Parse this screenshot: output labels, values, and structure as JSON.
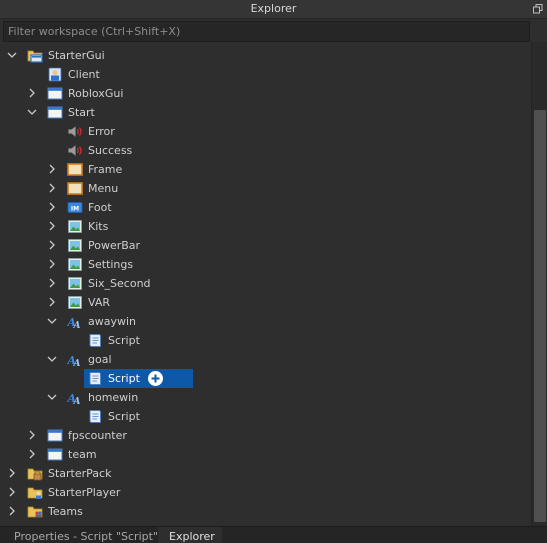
{
  "window": {
    "title": "Explorer"
  },
  "filter": {
    "placeholder": "Filter workspace (Ctrl+Shift+X)"
  },
  "tree": [
    {
      "label": "StarterGui",
      "icon": "startergui-folder-icon",
      "chevron": "down",
      "depth": 0
    },
    {
      "label": "Client",
      "icon": "localscript-icon",
      "chevron": "none",
      "depth": 1
    },
    {
      "label": "RobloxGui",
      "icon": "screengui-icon",
      "chevron": "right",
      "depth": 1
    },
    {
      "label": "Start",
      "icon": "screengui-icon",
      "chevron": "down",
      "depth": 1
    },
    {
      "label": "Error",
      "icon": "sound-icon",
      "chevron": "none",
      "depth": 2
    },
    {
      "label": "Success",
      "icon": "sound-icon",
      "chevron": "none",
      "depth": 2
    },
    {
      "label": "Frame",
      "icon": "frame-icon",
      "chevron": "right",
      "depth": 2
    },
    {
      "label": "Menu",
      "icon": "frame-icon",
      "chevron": "right",
      "depth": 2
    },
    {
      "label": "Foot",
      "icon": "imagebutton-icon",
      "chevron": "right",
      "depth": 2
    },
    {
      "label": "Kits",
      "icon": "imagelabel-icon",
      "chevron": "right",
      "depth": 2
    },
    {
      "label": "PowerBar",
      "icon": "imagelabel-icon",
      "chevron": "right",
      "depth": 2
    },
    {
      "label": "Settings",
      "icon": "imagelabel-icon",
      "chevron": "right",
      "depth": 2
    },
    {
      "label": "Six_Second",
      "icon": "imagelabel-icon",
      "chevron": "right",
      "depth": 2
    },
    {
      "label": "VAR",
      "icon": "imagelabel-icon",
      "chevron": "right",
      "depth": 2
    },
    {
      "label": "awaywin",
      "icon": "textlabel-icon",
      "chevron": "down",
      "depth": 2
    },
    {
      "label": "Script",
      "icon": "script-icon",
      "chevron": "none",
      "depth": 3
    },
    {
      "label": "goal",
      "icon": "textlabel-icon",
      "chevron": "down",
      "depth": 2
    },
    {
      "label": "Script",
      "icon": "script-icon",
      "chevron": "none",
      "depth": 3,
      "selected": true
    },
    {
      "label": "homewin",
      "icon": "textlabel-icon",
      "chevron": "down",
      "depth": 2
    },
    {
      "label": "Script",
      "icon": "script-icon",
      "chevron": "none",
      "depth": 3
    },
    {
      "label": "fpscounter",
      "icon": "screengui-icon",
      "chevron": "right",
      "depth": 1
    },
    {
      "label": "team",
      "icon": "screengui-icon",
      "chevron": "right",
      "depth": 1
    },
    {
      "label": "StarterPack",
      "icon": "starterpack-folder-icon",
      "chevron": "right",
      "depth": 0
    },
    {
      "label": "StarterPlayer",
      "icon": "starterplayer-folder-icon",
      "chevron": "right",
      "depth": 0
    },
    {
      "label": "Teams",
      "icon": "teams-folder-icon",
      "chevron": "right",
      "depth": 0
    }
  ],
  "tabs": [
    {
      "label": "Properties - Script \"Script\"",
      "active": false
    },
    {
      "label": "Explorer",
      "active": true
    }
  ],
  "colors": {
    "background": "#2e2e2e",
    "selection": "#0e58a8",
    "text": "#cfcfcf"
  }
}
